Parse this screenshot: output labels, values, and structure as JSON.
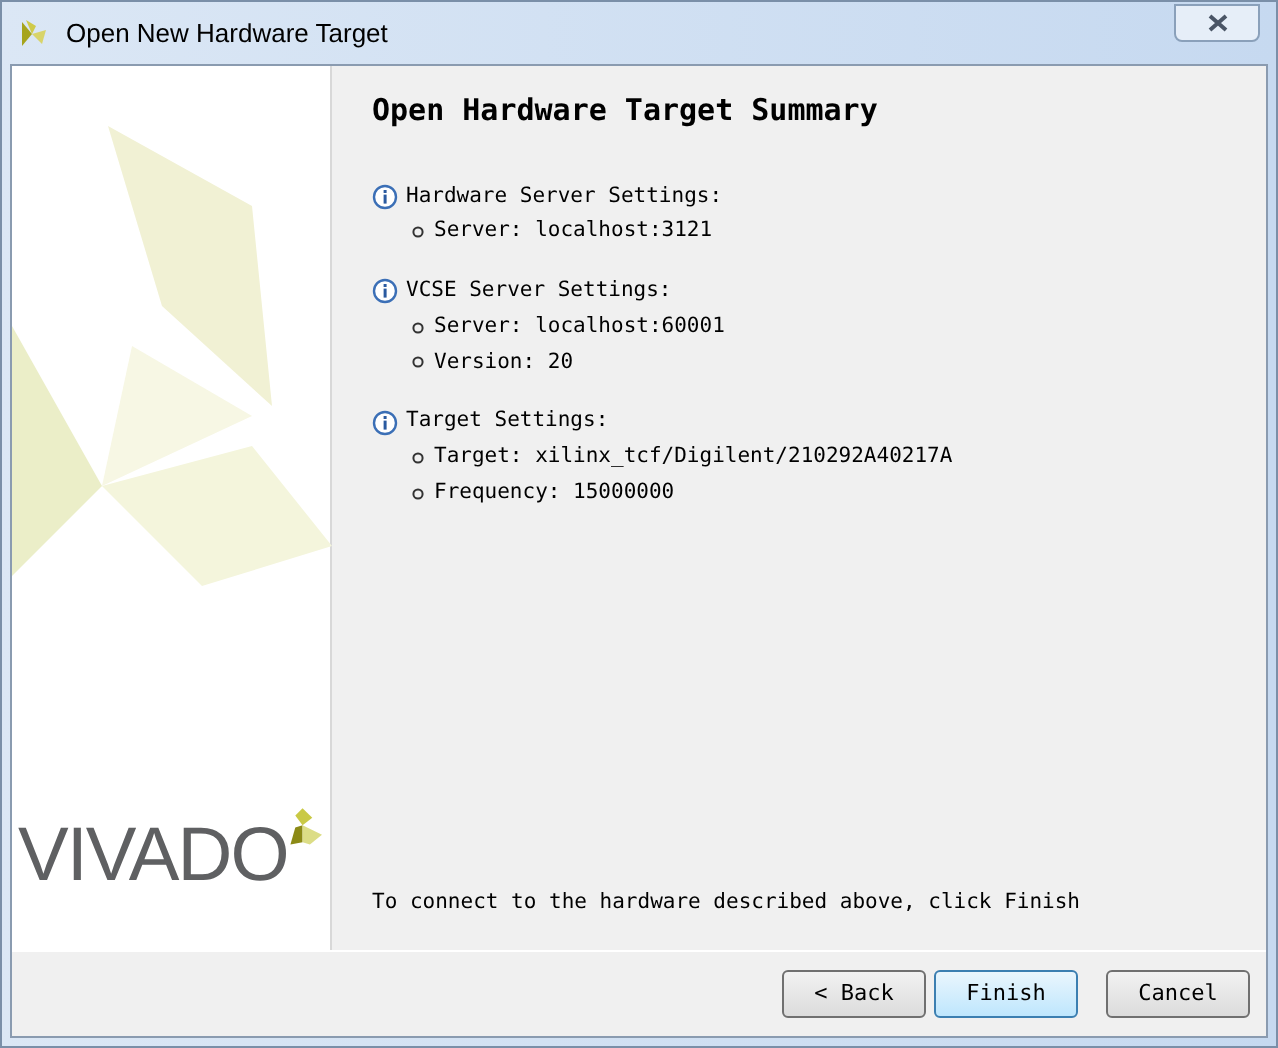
{
  "window": {
    "title": "Open New Hardware Target"
  },
  "logo": {
    "text": "VIVADO"
  },
  "summary": {
    "heading": "Open Hardware Target Summary",
    "sections": [
      {
        "title": "Hardware Server Settings:",
        "items": [
          "Server: localhost:3121"
        ]
      },
      {
        "title": "VCSE Server Settings:",
        "items": [
          "Server: localhost:60001",
          "Version: 20"
        ]
      },
      {
        "title": "Target Settings:",
        "items": [
          "Target: xilinx_tcf/Digilent/210292A40217A",
          "Frequency: 15000000"
        ]
      }
    ],
    "footer": "To connect to the hardware described above, click Finish"
  },
  "buttons": [
    {
      "label": "< Back",
      "default": false
    },
    {
      "label": "Finish",
      "default": true
    },
    {
      "label": "Cancel",
      "default": false
    }
  ]
}
